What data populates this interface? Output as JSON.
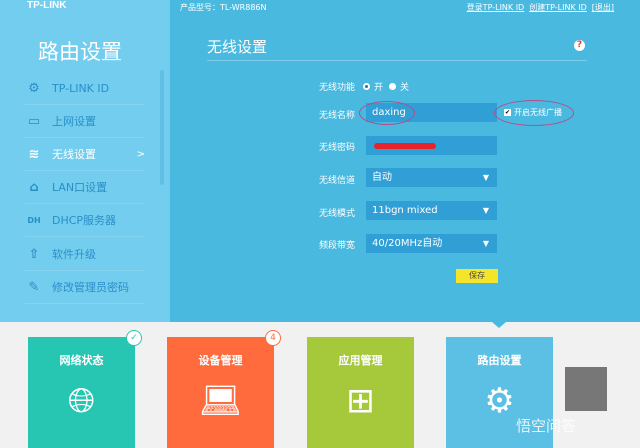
{
  "header": {
    "logo": "TP-LINK",
    "model": "产品型号：TL-WR886N",
    "links": [
      "登录TP-LINK ID",
      "创建TP-LINK ID",
      "[退出]"
    ]
  },
  "sidebar": {
    "title": "路由设置",
    "items": [
      {
        "label": "TP-LINK ID",
        "icon": "⚙"
      },
      {
        "label": "上网设置",
        "icon": "▭"
      },
      {
        "label": "无线设置",
        "icon": "≋",
        "active": true,
        "arrow": ">"
      },
      {
        "label": "LAN口设置",
        "icon": "⌂"
      },
      {
        "label": "DHCP服务器",
        "icon": "DH"
      },
      {
        "label": "软件升级",
        "icon": "⇧"
      },
      {
        "label": "修改管理员密码",
        "icon": "✎"
      }
    ]
  },
  "page": {
    "title": "无线设置",
    "help": "?",
    "wireless_function": {
      "label": "无线功能",
      "on": "开",
      "off": "关",
      "selected": "开"
    },
    "ssid": {
      "label": "无线名称",
      "value": "daxing"
    },
    "broadcast": {
      "label": "开启无线广播",
      "checked": true
    },
    "password": {
      "label": "无线密码",
      "value": ""
    },
    "channel": {
      "label": "无线信道",
      "value": "自动"
    },
    "mode": {
      "label": "无线模式",
      "value": "11bgn mixed"
    },
    "bandwidth": {
      "label": "频段带宽",
      "value": "40/20MHz自动"
    },
    "save": "保存"
  },
  "tiles": [
    {
      "label": "网络状态",
      "color": "#26c6b2",
      "badge": "✓"
    },
    {
      "label": "设备管理",
      "color": "#ff6b3d",
      "badge": "4"
    },
    {
      "label": "应用管理",
      "color": "#a5c93b"
    },
    {
      "label": "路由设置",
      "color": "#5bc0e4"
    }
  ],
  "watermark": "悟空问答"
}
